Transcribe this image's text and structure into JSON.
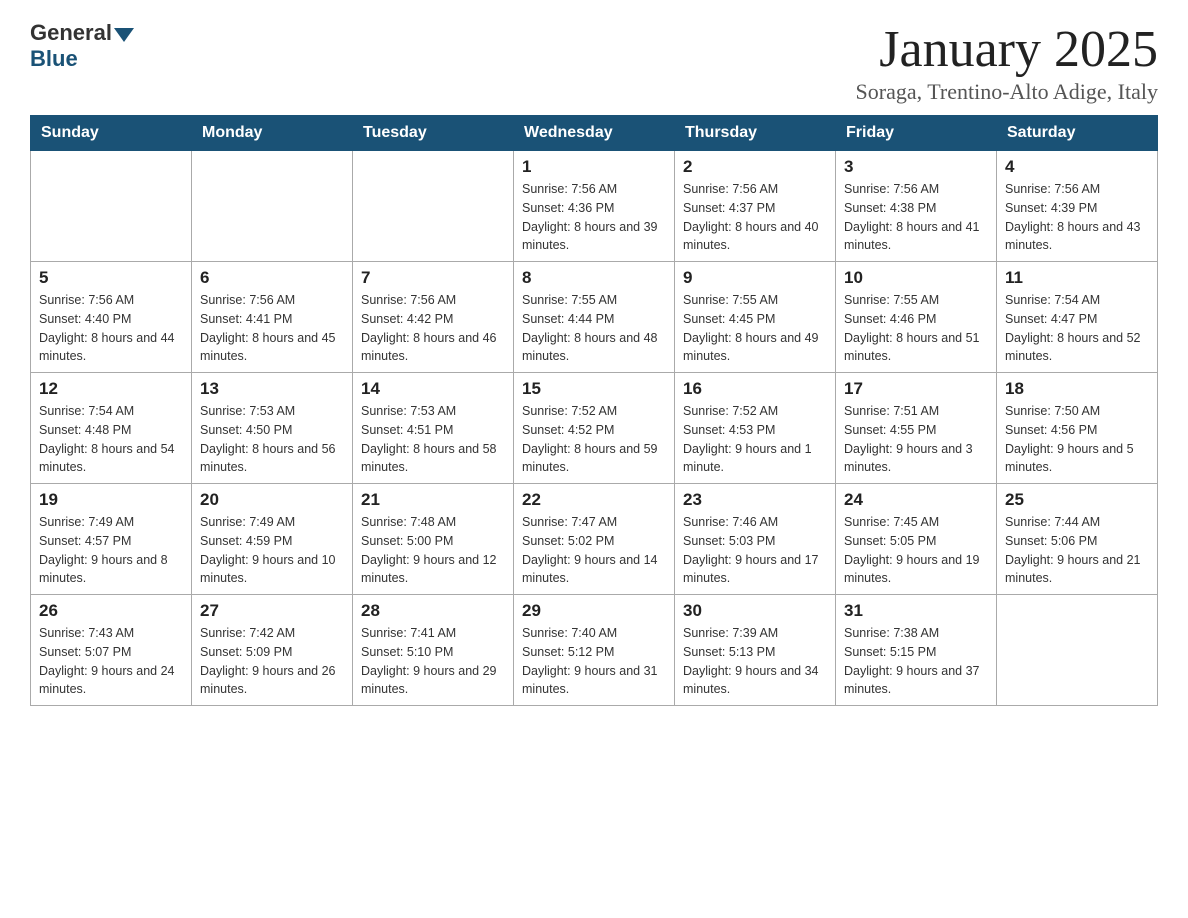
{
  "header": {
    "logo_general": "General",
    "logo_blue": "Blue",
    "month_title": "January 2025",
    "location": "Soraga, Trentino-Alto Adige, Italy"
  },
  "weekdays": [
    "Sunday",
    "Monday",
    "Tuesday",
    "Wednesday",
    "Thursday",
    "Friday",
    "Saturday"
  ],
  "weeks": [
    [
      {
        "day": "",
        "sunrise": "",
        "sunset": "",
        "daylight": ""
      },
      {
        "day": "",
        "sunrise": "",
        "sunset": "",
        "daylight": ""
      },
      {
        "day": "",
        "sunrise": "",
        "sunset": "",
        "daylight": ""
      },
      {
        "day": "1",
        "sunrise": "Sunrise: 7:56 AM",
        "sunset": "Sunset: 4:36 PM",
        "daylight": "Daylight: 8 hours and 39 minutes."
      },
      {
        "day": "2",
        "sunrise": "Sunrise: 7:56 AM",
        "sunset": "Sunset: 4:37 PM",
        "daylight": "Daylight: 8 hours and 40 minutes."
      },
      {
        "day": "3",
        "sunrise": "Sunrise: 7:56 AM",
        "sunset": "Sunset: 4:38 PM",
        "daylight": "Daylight: 8 hours and 41 minutes."
      },
      {
        "day": "4",
        "sunrise": "Sunrise: 7:56 AM",
        "sunset": "Sunset: 4:39 PM",
        "daylight": "Daylight: 8 hours and 43 minutes."
      }
    ],
    [
      {
        "day": "5",
        "sunrise": "Sunrise: 7:56 AM",
        "sunset": "Sunset: 4:40 PM",
        "daylight": "Daylight: 8 hours and 44 minutes."
      },
      {
        "day": "6",
        "sunrise": "Sunrise: 7:56 AM",
        "sunset": "Sunset: 4:41 PM",
        "daylight": "Daylight: 8 hours and 45 minutes."
      },
      {
        "day": "7",
        "sunrise": "Sunrise: 7:56 AM",
        "sunset": "Sunset: 4:42 PM",
        "daylight": "Daylight: 8 hours and 46 minutes."
      },
      {
        "day": "8",
        "sunrise": "Sunrise: 7:55 AM",
        "sunset": "Sunset: 4:44 PM",
        "daylight": "Daylight: 8 hours and 48 minutes."
      },
      {
        "day": "9",
        "sunrise": "Sunrise: 7:55 AM",
        "sunset": "Sunset: 4:45 PM",
        "daylight": "Daylight: 8 hours and 49 minutes."
      },
      {
        "day": "10",
        "sunrise": "Sunrise: 7:55 AM",
        "sunset": "Sunset: 4:46 PM",
        "daylight": "Daylight: 8 hours and 51 minutes."
      },
      {
        "day": "11",
        "sunrise": "Sunrise: 7:54 AM",
        "sunset": "Sunset: 4:47 PM",
        "daylight": "Daylight: 8 hours and 52 minutes."
      }
    ],
    [
      {
        "day": "12",
        "sunrise": "Sunrise: 7:54 AM",
        "sunset": "Sunset: 4:48 PM",
        "daylight": "Daylight: 8 hours and 54 minutes."
      },
      {
        "day": "13",
        "sunrise": "Sunrise: 7:53 AM",
        "sunset": "Sunset: 4:50 PM",
        "daylight": "Daylight: 8 hours and 56 minutes."
      },
      {
        "day": "14",
        "sunrise": "Sunrise: 7:53 AM",
        "sunset": "Sunset: 4:51 PM",
        "daylight": "Daylight: 8 hours and 58 minutes."
      },
      {
        "day": "15",
        "sunrise": "Sunrise: 7:52 AM",
        "sunset": "Sunset: 4:52 PM",
        "daylight": "Daylight: 8 hours and 59 minutes."
      },
      {
        "day": "16",
        "sunrise": "Sunrise: 7:52 AM",
        "sunset": "Sunset: 4:53 PM",
        "daylight": "Daylight: 9 hours and 1 minute."
      },
      {
        "day": "17",
        "sunrise": "Sunrise: 7:51 AM",
        "sunset": "Sunset: 4:55 PM",
        "daylight": "Daylight: 9 hours and 3 minutes."
      },
      {
        "day": "18",
        "sunrise": "Sunrise: 7:50 AM",
        "sunset": "Sunset: 4:56 PM",
        "daylight": "Daylight: 9 hours and 5 minutes."
      }
    ],
    [
      {
        "day": "19",
        "sunrise": "Sunrise: 7:49 AM",
        "sunset": "Sunset: 4:57 PM",
        "daylight": "Daylight: 9 hours and 8 minutes."
      },
      {
        "day": "20",
        "sunrise": "Sunrise: 7:49 AM",
        "sunset": "Sunset: 4:59 PM",
        "daylight": "Daylight: 9 hours and 10 minutes."
      },
      {
        "day": "21",
        "sunrise": "Sunrise: 7:48 AM",
        "sunset": "Sunset: 5:00 PM",
        "daylight": "Daylight: 9 hours and 12 minutes."
      },
      {
        "day": "22",
        "sunrise": "Sunrise: 7:47 AM",
        "sunset": "Sunset: 5:02 PM",
        "daylight": "Daylight: 9 hours and 14 minutes."
      },
      {
        "day": "23",
        "sunrise": "Sunrise: 7:46 AM",
        "sunset": "Sunset: 5:03 PM",
        "daylight": "Daylight: 9 hours and 17 minutes."
      },
      {
        "day": "24",
        "sunrise": "Sunrise: 7:45 AM",
        "sunset": "Sunset: 5:05 PM",
        "daylight": "Daylight: 9 hours and 19 minutes."
      },
      {
        "day": "25",
        "sunrise": "Sunrise: 7:44 AM",
        "sunset": "Sunset: 5:06 PM",
        "daylight": "Daylight: 9 hours and 21 minutes."
      }
    ],
    [
      {
        "day": "26",
        "sunrise": "Sunrise: 7:43 AM",
        "sunset": "Sunset: 5:07 PM",
        "daylight": "Daylight: 9 hours and 24 minutes."
      },
      {
        "day": "27",
        "sunrise": "Sunrise: 7:42 AM",
        "sunset": "Sunset: 5:09 PM",
        "daylight": "Daylight: 9 hours and 26 minutes."
      },
      {
        "day": "28",
        "sunrise": "Sunrise: 7:41 AM",
        "sunset": "Sunset: 5:10 PM",
        "daylight": "Daylight: 9 hours and 29 minutes."
      },
      {
        "day": "29",
        "sunrise": "Sunrise: 7:40 AM",
        "sunset": "Sunset: 5:12 PM",
        "daylight": "Daylight: 9 hours and 31 minutes."
      },
      {
        "day": "30",
        "sunrise": "Sunrise: 7:39 AM",
        "sunset": "Sunset: 5:13 PM",
        "daylight": "Daylight: 9 hours and 34 minutes."
      },
      {
        "day": "31",
        "sunrise": "Sunrise: 7:38 AM",
        "sunset": "Sunset: 5:15 PM",
        "daylight": "Daylight: 9 hours and 37 minutes."
      },
      {
        "day": "",
        "sunrise": "",
        "sunset": "",
        "daylight": ""
      }
    ]
  ]
}
